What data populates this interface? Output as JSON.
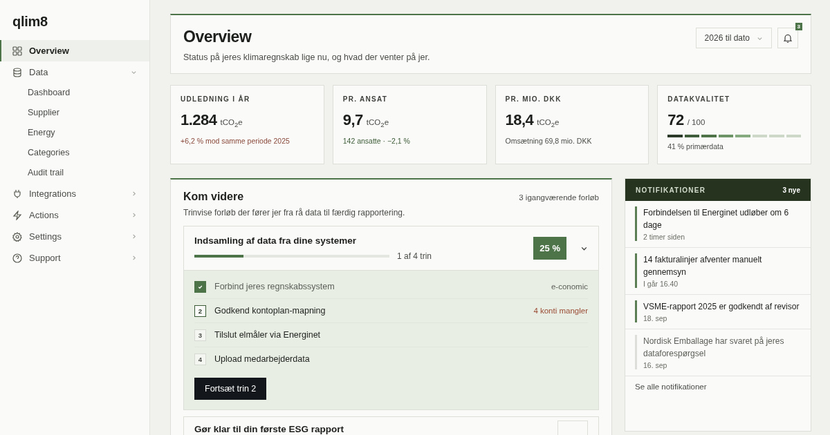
{
  "brand": "qlim8",
  "nav": [
    {
      "label": "Overview",
      "selected": true
    },
    {
      "label": "Data",
      "selected": false,
      "expanded": true,
      "children": [
        {
          "label": "Dashboard"
        },
        {
          "label": "Supplier"
        },
        {
          "label": "Energy"
        },
        {
          "label": "Categories"
        },
        {
          "label": "Audit trail"
        }
      ]
    },
    {
      "label": "Integrations",
      "selected": false,
      "expanded": false
    },
    {
      "label": "Actions",
      "selected": false,
      "expanded": false
    },
    {
      "label": "Settings",
      "selected": false,
      "expanded": false
    },
    {
      "label": "Support",
      "selected": false,
      "expanded": false
    }
  ],
  "header": {
    "title": "Overview",
    "subtitle": "Status på jeres klimaregnskab lige nu, og hvad der venter på jer.",
    "period": "2026 til dato",
    "badge": "3"
  },
  "stats": [
    {
      "label": "UDLEDNING I ÅR",
      "value": "1.284",
      "unit": "tCO$_{2}$e",
      "note": "+6,2 % mod samme periode 2025",
      "color": "#8a4a3c"
    },
    {
      "label": "PR. ANSAT",
      "value": "9,7",
      "unit": "tCO$_{2}$e",
      "note": "142 ansatte · −2,1 %",
      "color": "#3b5a36"
    },
    {
      "label": "PR. MIO. DKK",
      "value": "18,4",
      "unit": "tCO$_{2}$e",
      "note": "Omsætning 69,8 mio. DKK",
      "color": "#4a4d48"
    },
    {
      "label": "DATAKVALITET",
      "value": "72",
      "unit": "/ 100",
      "level": 0.625,
      "note": "41 % primærdata",
      "color": "#4a4d48"
    }
  ],
  "journeys": {
    "title": "Kom videre",
    "meta": "3 igangværende forløb",
    "subtitle": "Trinvise forløb der fører jer fra rå data til færdig rapportering.",
    "flows": [
      {
        "title": "Indsamling af data fra dine systemer",
        "level": 0.25,
        "progress": "1 af 4 trin",
        "percent": "25 %",
        "expanded": true,
        "steps": [
          {
            "done": true,
            "current": false,
            "label": "Forbind jeres regnskabssystem",
            "note": "e-conomic",
            "color": "#5c5f59"
          },
          {
            "done": false,
            "current": true,
            "number": "2",
            "label": "Godkend kontoplan-mapning",
            "note": "4 konti mangler",
            "color": "#9a4c36"
          },
          {
            "done": false,
            "current": false,
            "number": "3",
            "label": "Tilslut elmåler via Energinet"
          },
          {
            "done": false,
            "current": false,
            "number": "4",
            "label": "Upload medarbejderdata"
          }
        ],
        "button": "Fortsæt trin 2"
      },
      {
        "title": "Gør klar til din første ESG rapport",
        "expanded": false
      }
    ]
  },
  "notifications": {
    "title": "NOTIFIKATIONER",
    "count": "3 nye",
    "items": [
      {
        "text": "Forbindelsen til Energinet udløber om 6 dage",
        "time": "2 timer siden",
        "unread": true
      },
      {
        "text": "14 fakturalinjer afventer manuelt gennemsyn",
        "time": "I går 16.40",
        "unread": true
      },
      {
        "text": "VSME-rapport 2025 er godkendt af revisor",
        "time": "18. sep",
        "unread": true
      },
      {
        "text": "Nordisk Emballage har svaret på jeres dataforespørgsel",
        "time": "16. sep",
        "unread": false
      }
    ],
    "footer": "Se alle notifikationer"
  }
}
